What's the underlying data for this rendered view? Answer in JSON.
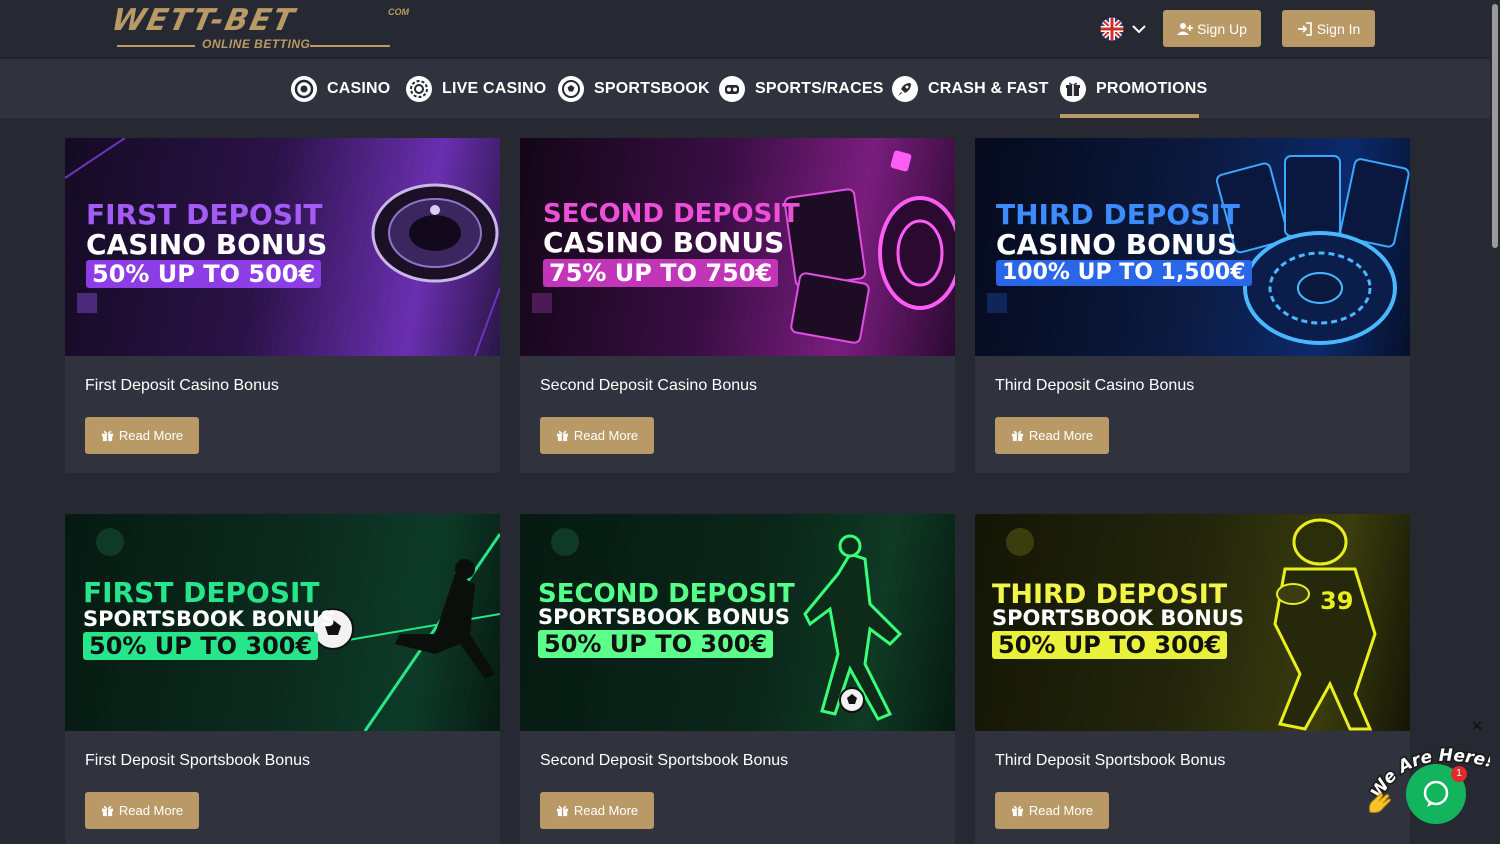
{
  "header": {
    "logo_main": "WETT-BET",
    "logo_com": "COM",
    "logo_sub": "ONLINE BETTING",
    "signup_label": "Sign Up",
    "signin_label": "Sign In"
  },
  "nav": {
    "items": [
      {
        "label": "CASINO",
        "icon": "roulette-chip-icon"
      },
      {
        "label": "LIVE CASINO",
        "icon": "live-chip-icon"
      },
      {
        "label": "SPORTSBOOK",
        "icon": "football-icon"
      },
      {
        "label": "SPORTS/RACES",
        "icon": "vr-headset-icon"
      },
      {
        "label": "CRASH & FAST",
        "icon": "rocket-icon"
      },
      {
        "label": "PROMOTIONS",
        "icon": "gift-icon",
        "active": true
      }
    ]
  },
  "promos": [
    {
      "title": "First Deposit Casino Bonus",
      "button": "Read More",
      "banner": {
        "line1": "FIRST DEPOSIT",
        "line2": "CASINO BONUS",
        "line3": "50% UP TO 500€"
      }
    },
    {
      "title": "Second Deposit Casino Bonus",
      "button": "Read More",
      "banner": {
        "line1": "SECOND DEPOSIT",
        "line2": "CASINO BONUS",
        "line3": "75% UP TO 750€"
      }
    },
    {
      "title": "Third Deposit Casino Bonus",
      "button": "Read More",
      "banner": {
        "line1": "THIRD DEPOSIT",
        "line2": "CASINO BONUS",
        "line3": "100% UP TO 1,500€"
      }
    },
    {
      "title": "First Deposit Sportsbook Bonus",
      "button": "Read More",
      "banner": {
        "line1": "FIRST DEPOSIT",
        "line2": "SPORTSBOOK BONUS",
        "line3": "50% UP TO 300€"
      }
    },
    {
      "title": "Second Deposit Sportsbook Bonus",
      "button": "Read More",
      "banner": {
        "line1": "SECOND DEPOSIT",
        "line2": "SPORTSBOOK BONUS",
        "line3": "50% UP TO 300€"
      }
    },
    {
      "title": "Third Deposit Sportsbook Bonus",
      "button": "Read More",
      "banner": {
        "line1": "THIRD DEPOSIT",
        "line2": "SPORTSBOOK BONUS",
        "line3": "50% UP TO 300€"
      }
    }
  ],
  "chat": {
    "tagline": "We Are Here!",
    "badge": "1"
  },
  "colors": {
    "accent": "#b99a67",
    "page_bg": "#262932",
    "card_bg": "#30333d",
    "chat_green": "#13b45e"
  }
}
